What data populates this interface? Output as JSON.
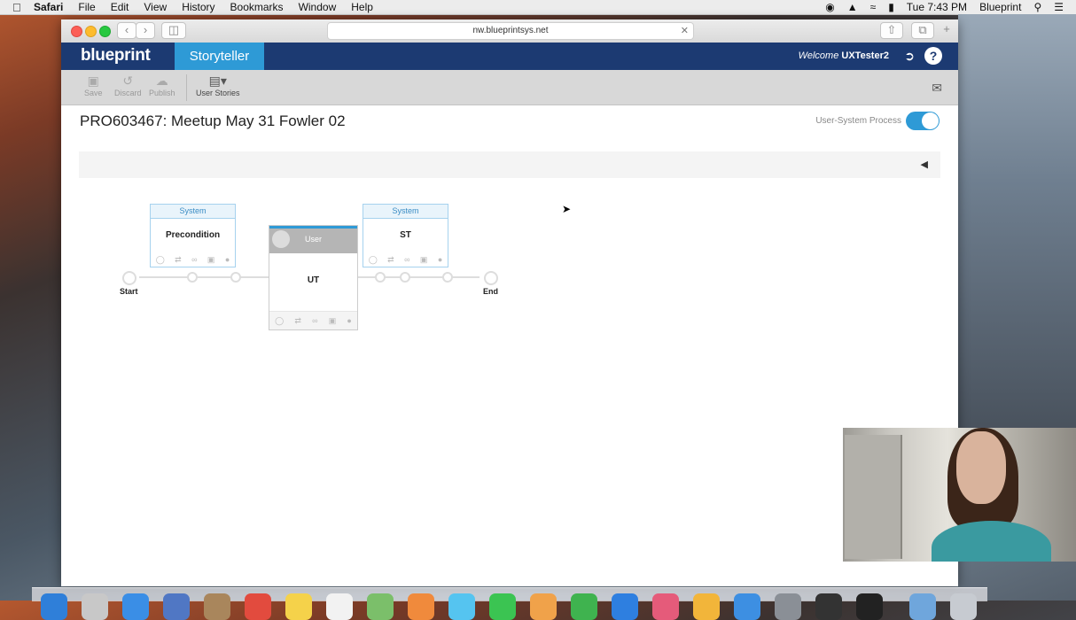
{
  "menubar": {
    "app_name": "Safari",
    "items": [
      "File",
      "Edit",
      "View",
      "History",
      "Bookmarks",
      "Window",
      "Help"
    ],
    "clock": "Tue 7:43 PM",
    "user": "Blueprint"
  },
  "browser": {
    "url": "nw.blueprintsys.net"
  },
  "app_header": {
    "logo": "blueprint",
    "active_tab": "Storyteller",
    "welcome_prefix": "Welcome",
    "username": "UXTester2",
    "help_label": "?"
  },
  "toolbar": {
    "save": "Save",
    "discard": "Discard",
    "publish": "Publish",
    "user_stories": "User Stories"
  },
  "page": {
    "title": "PRO603467: Meetup May 31 Fowler 02",
    "toggle_label": "User-System Process",
    "toggle_on": true
  },
  "diagram": {
    "start_label": "Start",
    "end_label": "End",
    "tasks": [
      {
        "type": "System",
        "name": "Precondition"
      },
      {
        "type": "User",
        "name": "UT"
      },
      {
        "type": "System",
        "name": "ST"
      }
    ]
  },
  "colors": {
    "header_bg": "#1c3a72",
    "accent": "#2e9ad6",
    "toolbar_bg": "#d8d8d8"
  },
  "icons": {
    "save": "save-icon",
    "discard": "discard-icon",
    "publish": "publish-icon",
    "user_stories": "user-stories-icon",
    "mail": "mail-icon",
    "logout": "logout-icon"
  }
}
